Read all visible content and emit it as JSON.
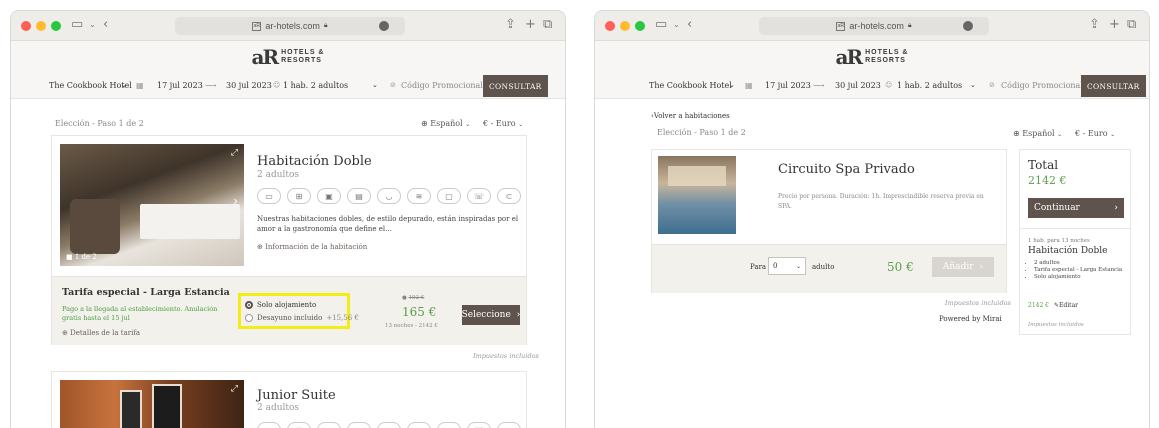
{
  "browser": {
    "url": "ar-hotels.com"
  },
  "logo": {
    "mark": "aR",
    "line1": "HOTELS &",
    "line2": "RESORTS"
  },
  "search": {
    "hotel": "The Cookbook Hotel",
    "checkin": "17 jul 2023",
    "arrow": "⟶",
    "checkout": "30 jul 2023",
    "guests": "1 hab. 2 adultos",
    "promo_placeholder": "Código Promocional",
    "submit": "CONSULTAR"
  },
  "left": {
    "step": "Elección - Paso 1 de 2",
    "language": "Español",
    "currency": "€ - Euro",
    "room1": {
      "title": "Habitación Doble",
      "guests": "2 adultos",
      "photo_counter": "1 de 2",
      "amenities": [
        "air-conditioning-icon",
        "safe-icon",
        "minibar-icon",
        "tv-icon",
        "bathtub-icon",
        "wifi-icon",
        "desk-icon",
        "phone-icon",
        "hairdryer-icon"
      ],
      "description": "Nuestras habitaciones dobles, de estilo depurado, están inspiradas por el amor a la gastronomía que define el...",
      "info_link": "Información de la habitación"
    },
    "rate": {
      "title": "Tarifa especial - Larga Estancia",
      "conditions": "Pago a la llegada al establecimiento. Anulación gratis hasta el 15 jul",
      "details_link": "Detalles de la tarifa",
      "option1": "Solo alojamiento",
      "option2": "Desayuno incluido",
      "option2_extra": "+15,56 €",
      "old_price": "192 €",
      "price": "165 €",
      "nights_total": "13 noches - 2142 €",
      "select_button": "Seleccione"
    },
    "taxes_note": "Impuestos incluidos",
    "room2": {
      "title": "Junior Suite",
      "guests": "2 adultos"
    }
  },
  "right": {
    "back_link": "Volver a habitaciones",
    "step": "Elección - Paso 1 de 2",
    "language": "Español",
    "currency": "€ - Euro",
    "service": {
      "title": "Circuito Spa Privado",
      "description": "Precio por persona. Duración: 1h. Imprescindible reserva previa en SPA.",
      "para_label": "Para",
      "qty": "0",
      "unit": "adulto",
      "price": "50 €",
      "add_button": "Añadir"
    },
    "taxes_note": "Impuestos incluidos",
    "powered": "Powered by Mirai",
    "total": {
      "label": "Total",
      "amount": "2142 €",
      "continue_button": "Continuar",
      "summary_line": "1 hab. para 13 noches",
      "room_name": "Habitación Doble",
      "bullets": [
        "2 adultos",
        "Tarifa especial - Larga Estancia",
        "Solo alojamiento"
      ],
      "room_price": "2142 €",
      "edit": "Editar",
      "taxes": "Impuestos incluidos"
    }
  }
}
